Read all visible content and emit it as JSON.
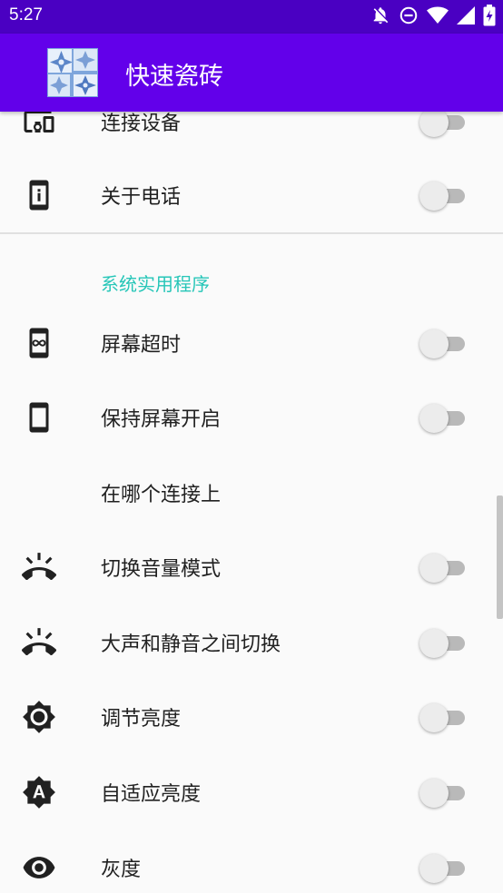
{
  "status_bar": {
    "time": "5:27",
    "icons": [
      "notifications-off-icon",
      "do-not-disturb-icon",
      "wifi-icon",
      "signal-icon",
      "battery-charging-icon"
    ],
    "color": "#4a00c2"
  },
  "app_bar": {
    "title": "快速瓷砖",
    "logo_icon": "tile-logo-icon",
    "color": "#6200ea"
  },
  "section_header": "系统实用程序",
  "section_header_color": "#26c6b8",
  "items": [
    {
      "label": "连接设备",
      "icon": "devices-icon",
      "toggle": false
    },
    {
      "label": "关于电话",
      "icon": "phone-info-icon",
      "toggle": false
    },
    {
      "label": "屏幕超时",
      "icon": "screen-timeout-icon",
      "toggle": false
    },
    {
      "label": "保持屏幕开启",
      "icon": "smartphone-icon",
      "toggle": false
    },
    {
      "label": "在哪个连接上",
      "icon": "",
      "toggle": null
    },
    {
      "label": "切换音量模式",
      "icon": "ring-volume-icon",
      "toggle": false
    },
    {
      "label": "大声和静音之间切换",
      "icon": "ring-volume-icon",
      "toggle": false
    },
    {
      "label": "调节亮度",
      "icon": "brightness-icon",
      "toggle": false
    },
    {
      "label": "自适应亮度",
      "icon": "brightness-auto-icon",
      "toggle": false
    },
    {
      "label": "灰度",
      "icon": "eye-icon",
      "toggle": false
    }
  ]
}
